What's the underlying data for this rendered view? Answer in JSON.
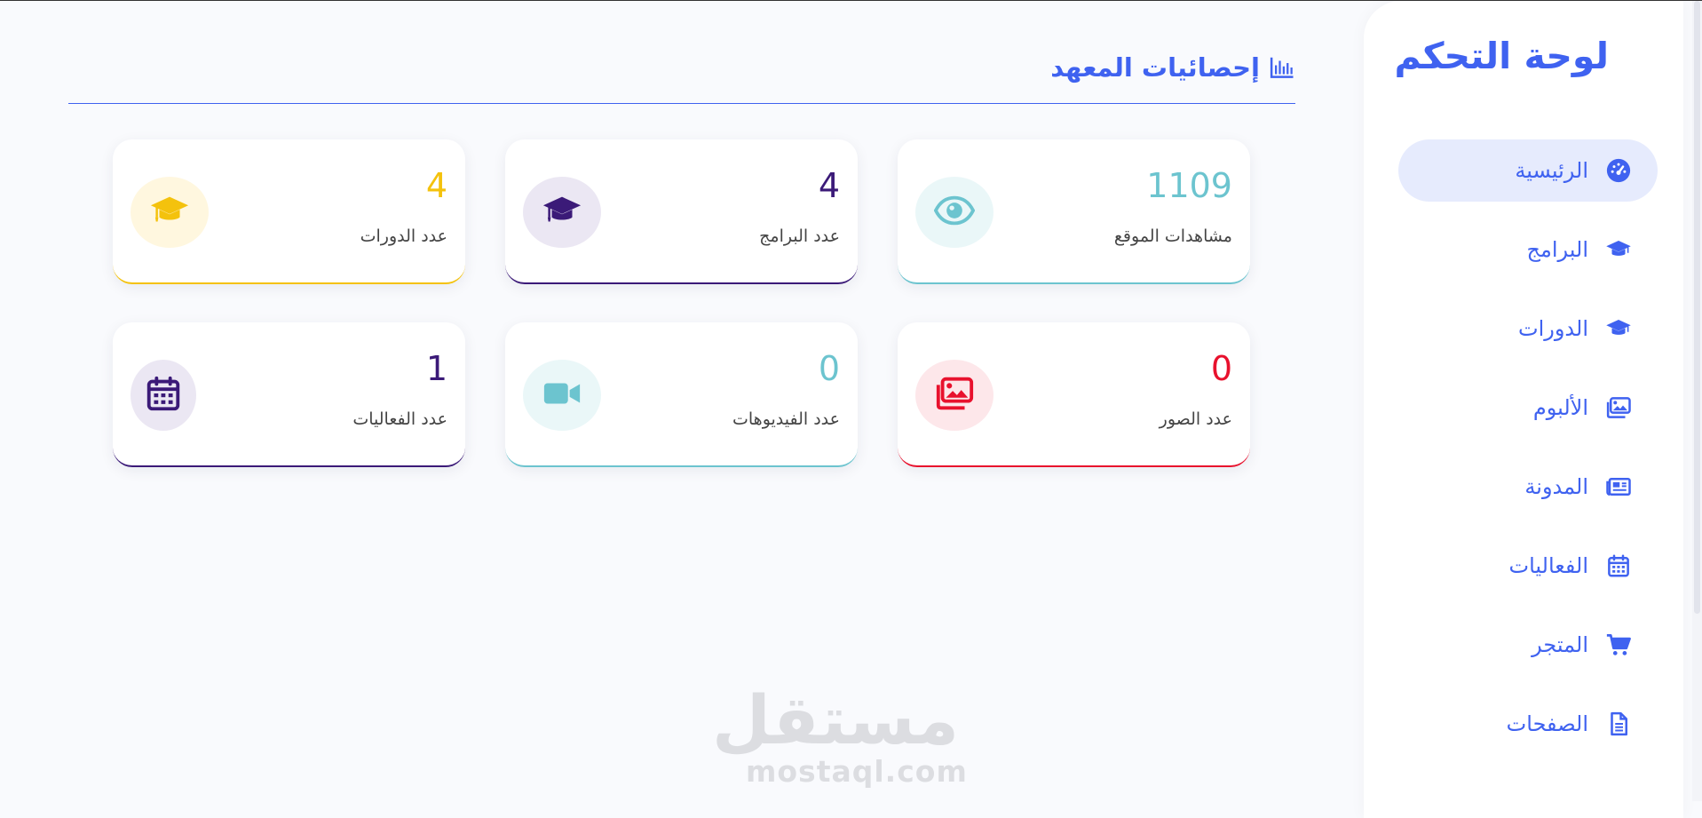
{
  "sidebar": {
    "title": "لوحة التحكم",
    "items": [
      {
        "label": "الرئيسية",
        "icon": "dashboard-icon",
        "active": true
      },
      {
        "label": "البرامج",
        "icon": "graduation-cap-icon"
      },
      {
        "label": "الدورات",
        "icon": "graduation-cap-icon"
      },
      {
        "label": "الألبوم",
        "icon": "images-icon"
      },
      {
        "label": "المدونة",
        "icon": "newspaper-icon"
      },
      {
        "label": "الفعاليات",
        "icon": "calendar-icon"
      },
      {
        "label": "المتجر",
        "icon": "cart-icon"
      },
      {
        "label": "الصفحات",
        "icon": "file-icon"
      }
    ]
  },
  "main": {
    "section_title": "إحصائيات المعهد",
    "section_icon": "bar-chart-icon",
    "cards": [
      {
        "value": "1109",
        "label": "مشاهدات الموقع",
        "icon": "eye-icon",
        "color": "#6cc4cf",
        "badge_bg": "#eaf7f8"
      },
      {
        "value": "4",
        "label": "عدد البرامج",
        "icon": "graduation-cap-icon",
        "color": "#3b1a78",
        "badge_bg": "#ebe7f3"
      },
      {
        "value": "4",
        "label": "عدد الدورات",
        "icon": "graduation-cap-icon",
        "color": "#f4c20d",
        "badge_bg": "#fff7df"
      },
      {
        "value": "0",
        "label": "عدد الصور",
        "icon": "images-icon",
        "color": "#e8112d",
        "badge_bg": "#fde7ea"
      },
      {
        "value": "0",
        "label": "عدد الفيديوهات",
        "icon": "video-icon",
        "color": "#6cc4cf",
        "badge_bg": "#eaf7f8"
      },
      {
        "value": "1",
        "label": "عدد الفعاليات",
        "icon": "calendar-icon",
        "color": "#3b1a78",
        "badge_bg": "#ebe7f3"
      }
    ]
  },
  "watermark": {
    "arabic": "مستقل",
    "latin": "mostaql.com"
  },
  "colors": {
    "accent": "#3f62f0",
    "active_bg": "#e6ebfd"
  }
}
